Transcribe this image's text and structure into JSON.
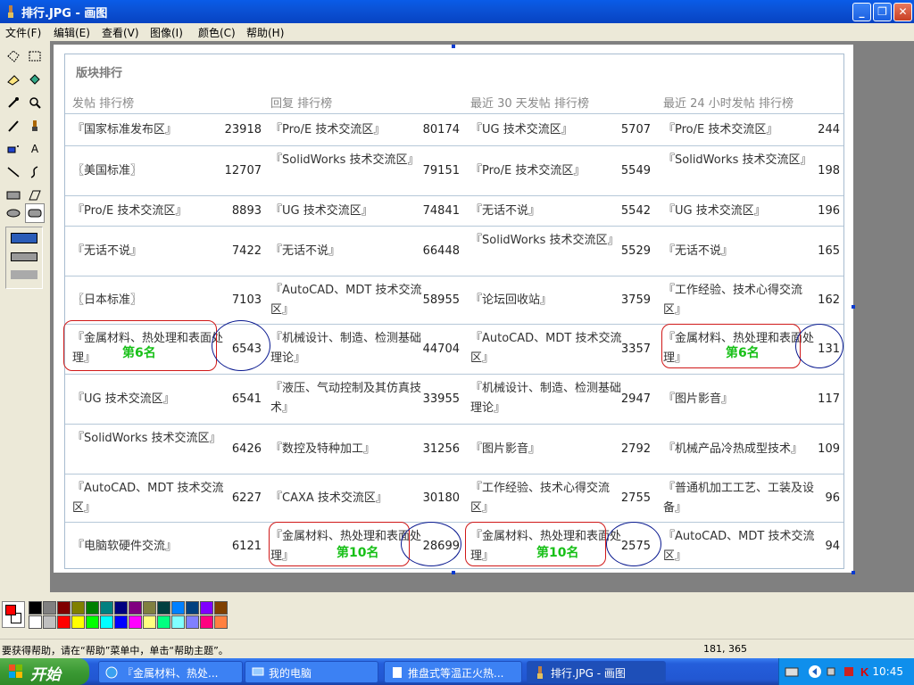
{
  "window": {
    "title": "排行.JPG - 画图"
  },
  "menu": [
    "文件(F)",
    "编辑(E)",
    "查看(V)",
    "图像(I)",
    "颜色(C)",
    "帮助(H)"
  ],
  "board": {
    "section_title": "版块排行",
    "headers": [
      "发帖 排行榜",
      "回复 排行榜",
      "最近 30 天发帖 排行榜",
      "最近 24 小时发帖 排行榜"
    ],
    "rows": [
      [
        [
          "『国家标准发布区』",
          "23918"
        ],
        [
          "『Pro/E 技术交流区』",
          "80174"
        ],
        [
          "『UG 技术交流区』",
          "5707"
        ],
        [
          "『Pro/E 技术交流区』",
          "244"
        ]
      ],
      [
        [
          "〖美国标准〗",
          "12707"
        ],
        [
          "『SolidWorks 技术交流区』",
          "79151"
        ],
        [
          "『Pro/E 技术交流区』",
          "5549"
        ],
        [
          "『SolidWorks 技术交流区』",
          "198"
        ]
      ],
      [
        [
          "『Pro/E 技术交流区』",
          "8893"
        ],
        [
          "『UG 技术交流区』",
          "74841"
        ],
        [
          "『无话不说』",
          "5542"
        ],
        [
          "『UG 技术交流区』",
          "196"
        ]
      ],
      [
        [
          "『无话不说』",
          "7422"
        ],
        [
          "『无话不说』",
          "66448"
        ],
        [
          "『SolidWorks 技术交流区』",
          "5529"
        ],
        [
          "『无话不说』",
          "165"
        ]
      ],
      [
        [
          "〖日本标准〗",
          "7103"
        ],
        [
          "『AutoCAD、MDT 技术交流区』",
          "58955"
        ],
        [
          "『论坛回收站』",
          "3759"
        ],
        [
          "『工作经验、技术心得交流区』",
          "162"
        ]
      ],
      [
        [
          "『金属材料、热处理和表面处理』",
          "6543"
        ],
        [
          "『机械设计、制造、检测基础理论』",
          "44704"
        ],
        [
          "『AutoCAD、MDT 技术交流区』",
          "3357"
        ],
        [
          "『金属材料、热处理和表面处理』",
          "131"
        ]
      ],
      [
        [
          "『UG 技术交流区』",
          "6541"
        ],
        [
          "『液压、气动控制及其仿真技术』",
          "33955"
        ],
        [
          "『机械设计、制造、检测基础理论』",
          "2947"
        ],
        [
          "『图片影音』",
          "117"
        ]
      ],
      [
        [
          "『SolidWorks 技术交流区』",
          "6426"
        ],
        [
          "『数控及特种加工』",
          "31256"
        ],
        [
          "『图片影音』",
          "2792"
        ],
        [
          "『机械产品冷热成型技术』",
          "109"
        ]
      ],
      [
        [
          "『AutoCAD、MDT 技术交流区』",
          "6227"
        ],
        [
          "『CAXA 技术交流区』",
          "30180"
        ],
        [
          "『工作经验、技术心得交流区』",
          "2755"
        ],
        [
          "『普通机加工工艺、工装及设备』",
          "96"
        ]
      ],
      [
        [
          "『电脑软硬件交流』",
          "6121"
        ],
        [
          "『金属材料、热处理和表面处理』",
          "28699"
        ],
        [
          "『金属材料、热处理和表面处理』",
          "2575"
        ],
        [
          "『AutoCAD、MDT 技术交流区』",
          "94"
        ]
      ]
    ],
    "annotations": {
      "rank6": "第6名",
      "rank10": "第10名"
    }
  },
  "palette": [
    "#000000",
    "#808080",
    "#800000",
    "#808000",
    "#008000",
    "#008080",
    "#000080",
    "#800080",
    "#808040",
    "#004040",
    "#0080ff",
    "#004080",
    "#8000ff",
    "#804000",
    "#ffffff",
    "#c0c0c0",
    "#ff0000",
    "#ffff00",
    "#00ff00",
    "#00ffff",
    "#0000ff",
    "#ff00ff",
    "#ffff80",
    "#00ff80",
    "#80ffff",
    "#8080ff",
    "#ff0080",
    "#ff8040"
  ],
  "status": {
    "help": "要获得帮助，请在“帮助”菜单中，单击“帮助主题”。",
    "coords": "181, 365"
  },
  "taskbar": {
    "start": "开始",
    "tasks": [
      "『金属材料、热处...",
      "我的电脑",
      "推盘式等温正火热...",
      "排行.JPG - 画图"
    ],
    "clock": "10:45"
  }
}
